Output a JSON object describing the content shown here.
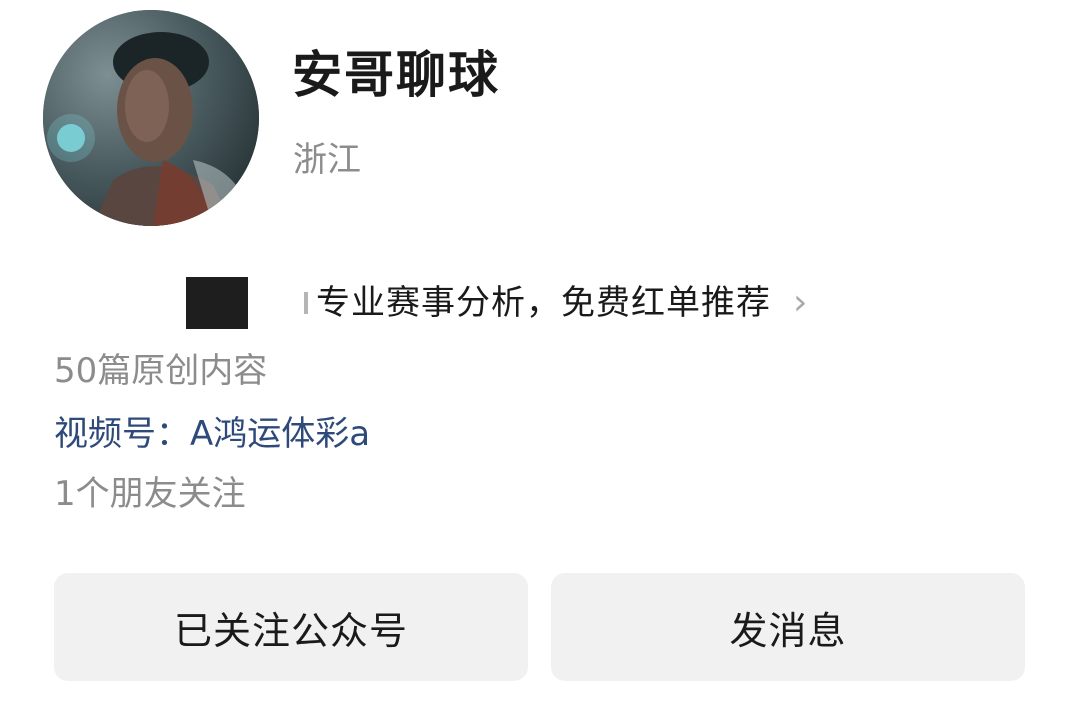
{
  "profile": {
    "avatar_icon": "avatar-photo",
    "name": "安哥聊球",
    "region": "浙江",
    "bio": "专业赛事分析，免费红单推荐",
    "bio_chevron": "›"
  },
  "stats": {
    "original_content": "50篇原创内容",
    "video_channel": "视频号：A鸿运体彩a",
    "friends_following": "1个朋友关注"
  },
  "actions": {
    "follow_label": "已关注公众号",
    "message_label": "发消息"
  }
}
